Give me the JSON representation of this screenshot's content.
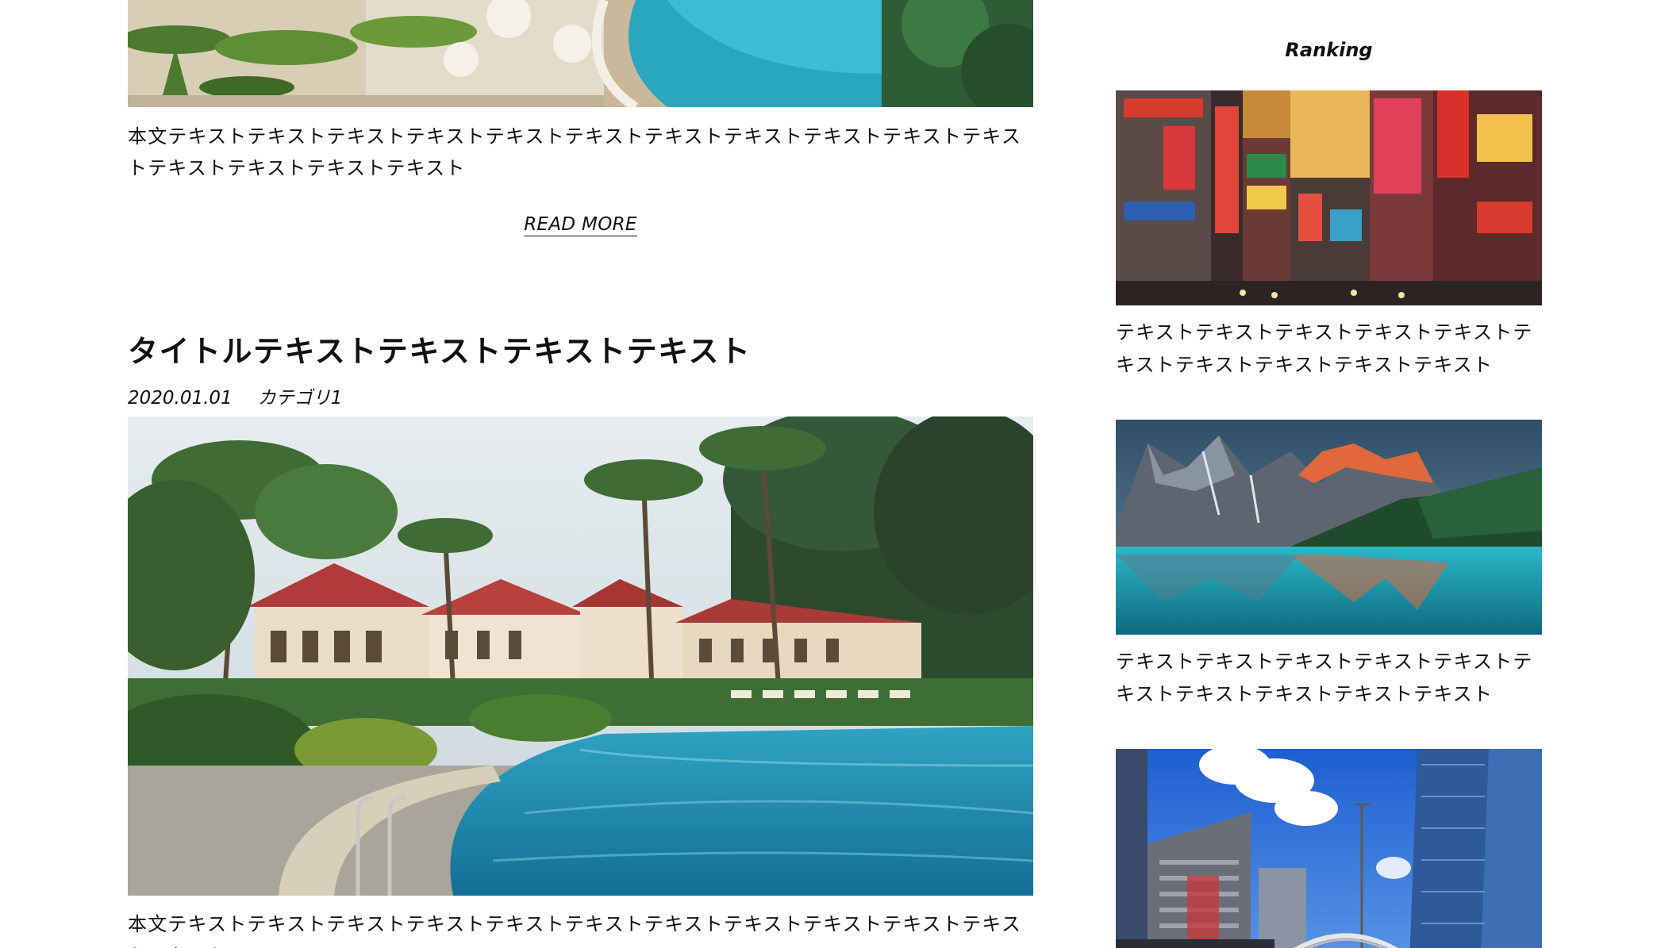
{
  "posts": [
    {
      "image_alt": "resort-pool-aerial",
      "body": "本文テキストテキストテキストテキストテキストテキストテキストテキストテキストテキストテキストテキストテキストテキストテキスト",
      "read_more": "READ MORE"
    },
    {
      "title": "タイトルテキストテキストテキストテキスト",
      "date": "2020.01.01",
      "category": "カテゴリ1",
      "image_alt": "resort-pool-palms",
      "body": "本文テキストテキストテキストテキストテキストテキストテキストテキストテキストテキストテキストテキストテ"
    }
  ],
  "sidebar": {
    "heading": "Ranking",
    "items": [
      {
        "image_alt": "city-neon-signs",
        "text": "テキストテキストテキストテキストテキストテキストテキストテキストテキストテキスト"
      },
      {
        "image_alt": "mountain-lake",
        "text": "テキストテキストテキストテキストテキストテキストテキストテキストテキストテキスト"
      },
      {
        "image_alt": "skyscrapers-sky",
        "text": ""
      }
    ]
  },
  "colors": {
    "text": "#111111",
    "background": "#ffffff",
    "pool": "#1b8fb8",
    "sky": "#3b7ed8"
  }
}
